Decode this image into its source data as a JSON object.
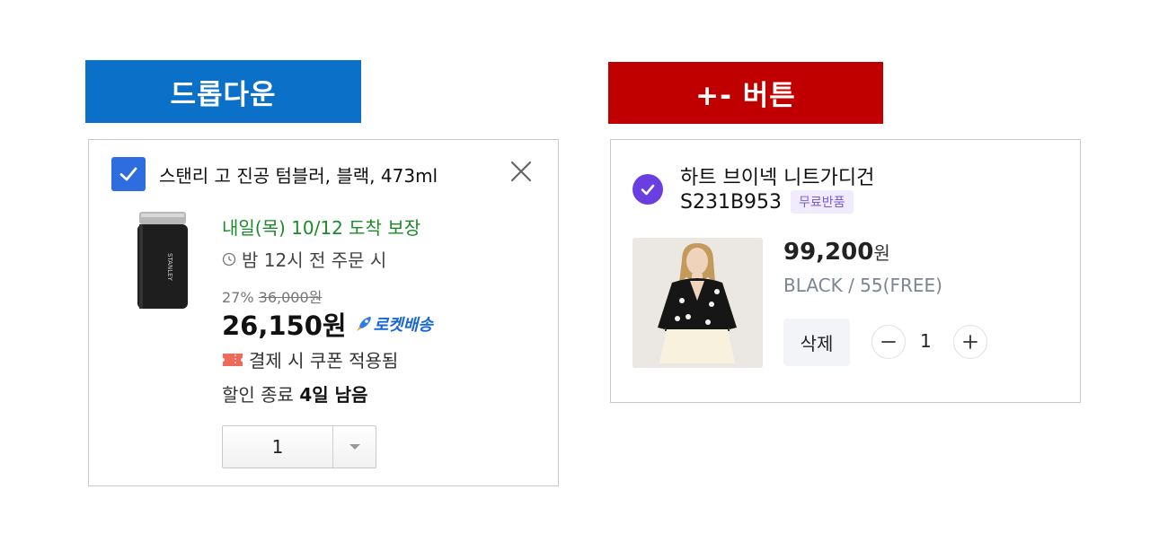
{
  "banners": {
    "left": "드롭다운",
    "right": "+- 버튼"
  },
  "left_card": {
    "title": "스탠리 고 진공 텀블러, 블랙, 473ml",
    "delivery": "내일(목) 10/12 도착 보장",
    "order_cutoff": "밤 12시 전 주문 시",
    "discount_rate": "27%",
    "original_price": "36,000원",
    "price": "26,150원",
    "rocket_label": "로켓배송",
    "coupon_text": "결제 시 쿠폰 적용됨",
    "sale_end_prefix": "할인 종료",
    "sale_end_remaining": "4일 남음",
    "quantity": "1",
    "tumbler_brand": "STANLEY",
    "colors": {
      "delivery_green": "#1c8a2a",
      "checkbox_blue": "#2d6de0",
      "rocket_blue": "#1967d2"
    }
  },
  "right_card": {
    "title": "하트 브이넥 니트가디건",
    "sku": "S231B953",
    "free_return_badge": "무료반품",
    "price_number": "99,200",
    "price_unit": "원",
    "option": "BLACK / 55(FREE)",
    "delete_label": "삭제",
    "quantity": "1",
    "colors": {
      "check_purple": "#6a3ee0",
      "badge_purple": "#7b5ad6"
    }
  },
  "banner_colors": {
    "left": "#0a70c8",
    "right": "#c00000"
  },
  "icons": [
    "check-icon",
    "close-icon",
    "clock-icon",
    "rocket-icon",
    "coupon-icon",
    "chevron-down-icon",
    "minus-icon",
    "plus-icon"
  ]
}
